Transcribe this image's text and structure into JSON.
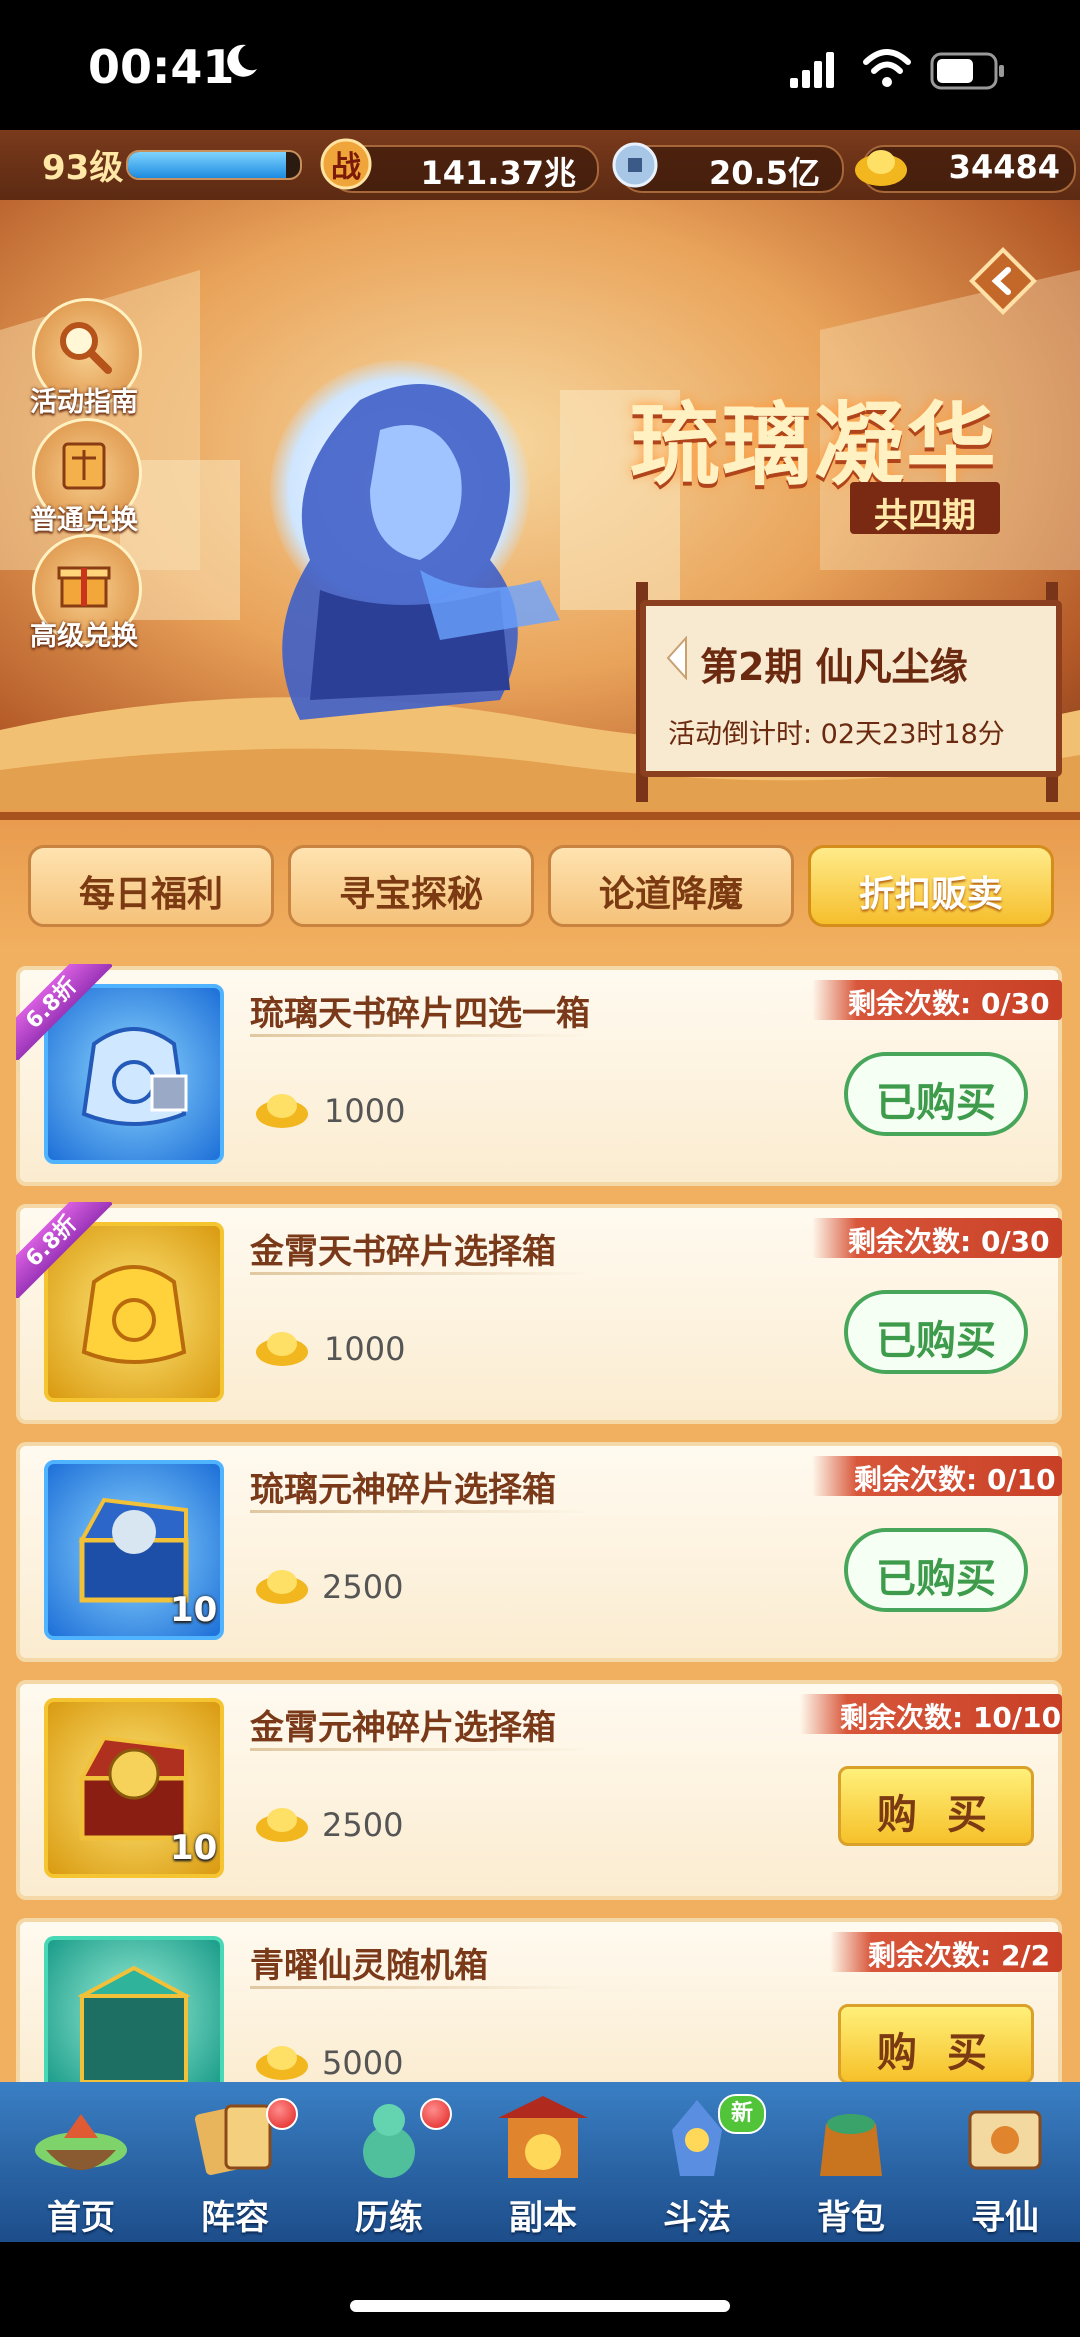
{
  "status_bar": {
    "time": "00:41"
  },
  "top_bar": {
    "level": "93级",
    "xp_fraction": 0.92,
    "power_icon_label": "战",
    "power": "141.37兆",
    "silver": "20.5亿",
    "gold": "34484"
  },
  "banner": {
    "title": "琉璃凝华",
    "subtitle": "共四期",
    "period_title": "第2期  仙凡尘缘",
    "countdown": "活动倒计时: 02天23时18分",
    "side_buttons": [
      "活动指南",
      "普通兑换",
      "高级兑换"
    ]
  },
  "tabs": [
    {
      "label": "每日福利",
      "active": false
    },
    {
      "label": "寻宝探秘",
      "active": false
    },
    {
      "label": "论道降魔",
      "active": false
    },
    {
      "label": "折扣贩卖",
      "active": true
    }
  ],
  "items": [
    {
      "name": "琉璃天书碎片四选一箱",
      "price": "1000",
      "remaining": "剩余次数: 0/30",
      "discount": "6.8折",
      "button": "已购买",
      "state": "bought",
      "qty": "",
      "icon": "blue-bag-icon"
    },
    {
      "name": "金霄天书碎片选择箱",
      "price": "1000",
      "remaining": "剩余次数: 0/30",
      "discount": "6.8折",
      "button": "已购买",
      "state": "bought",
      "qty": "",
      "icon": "gold-bag-icon"
    },
    {
      "name": "琉璃元神碎片选择箱",
      "price": "2500",
      "remaining": "剩余次数: 0/10",
      "discount": "",
      "button": "已购买",
      "state": "bought",
      "qty": "10",
      "icon": "blue-chest-icon"
    },
    {
      "name": "金霄元神碎片选择箱",
      "price": "2500",
      "remaining": "剩余次数: 10/10",
      "discount": "",
      "button": "购 买",
      "state": "buy",
      "qty": "10",
      "icon": "gold-chest-icon"
    },
    {
      "name": "青曜仙灵随机箱",
      "price": "5000",
      "remaining": "剩余次数: 2/2",
      "discount": "",
      "button": "购 买",
      "state": "buy",
      "qty": "",
      "icon": "teal-chest-icon"
    }
  ],
  "nav": [
    {
      "label": "首页",
      "dot": false,
      "badge": ""
    },
    {
      "label": "阵容",
      "dot": true,
      "badge": ""
    },
    {
      "label": "历练",
      "dot": true,
      "badge": ""
    },
    {
      "label": "副本",
      "dot": false,
      "badge": ""
    },
    {
      "label": "斗法",
      "dot": false,
      "badge": "新"
    },
    {
      "label": "背包",
      "dot": false,
      "badge": ""
    },
    {
      "label": "寻仙",
      "dot": false,
      "badge": ""
    }
  ],
  "colors": {
    "accent": "#f6c12a",
    "bought_green": "#3e9b4c",
    "remaining_red": "#c84026",
    "nav_blue": "#2a66a8"
  }
}
